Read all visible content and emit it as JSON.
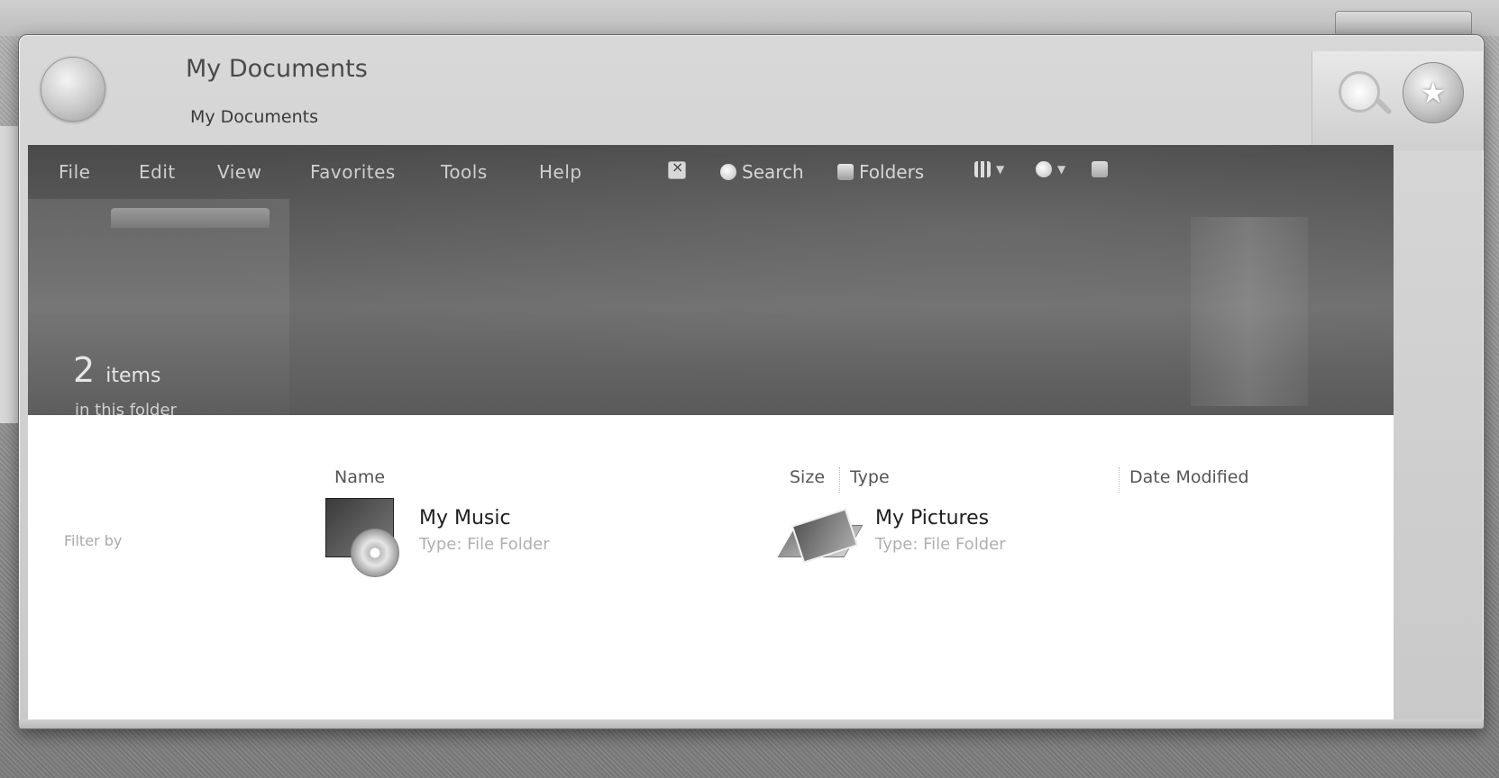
{
  "window": {
    "title": "My Documents",
    "subtitle": "My Documents"
  },
  "menu": {
    "items": [
      "File",
      "Edit",
      "View",
      "Favorites",
      "Tools",
      "Help"
    ]
  },
  "toolbar": {
    "search_label": "Search",
    "folders_label": "Folders"
  },
  "folder_info": {
    "count": "2",
    "count_unit": "items",
    "count_suffix": "in this folder"
  },
  "columns": {
    "name": "Name",
    "size": "Size",
    "type": "Type",
    "date_modified": "Date Modified"
  },
  "filter": {
    "label": "Filter by"
  },
  "items": [
    {
      "name": "My Music",
      "type": "Type: File Folder",
      "icon": "music-folder-icon"
    },
    {
      "name": "My Pictures",
      "type": "Type: File Folder",
      "icon": "pictures-folder-icon"
    }
  ]
}
